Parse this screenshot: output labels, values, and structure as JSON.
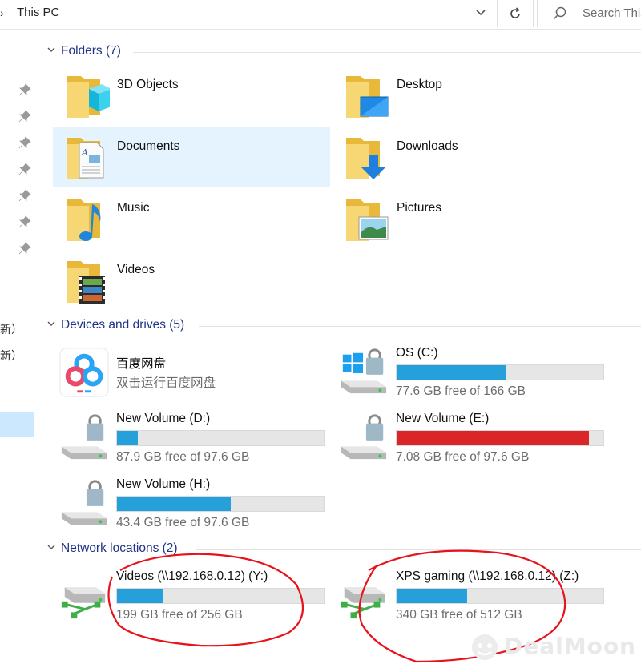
{
  "address_bar": {
    "path": "This PC",
    "search_placeholder": "Search This PC"
  },
  "nav": {
    "fragment_1": "更新）",
    "fragment_2": "更新）"
  },
  "groups": {
    "folders": {
      "title": "Folders (7)"
    },
    "devices": {
      "title": "Devices and drives (5)"
    },
    "network": {
      "title": "Network locations (2)"
    }
  },
  "folders": [
    {
      "name": "3D Objects"
    },
    {
      "name": "Desktop"
    },
    {
      "name": "Documents"
    },
    {
      "name": "Downloads"
    },
    {
      "name": "Music"
    },
    {
      "name": "Pictures"
    },
    {
      "name": "Videos"
    }
  ],
  "baidu": {
    "name": "百度网盘",
    "subtitle": "双击运行百度网盘"
  },
  "drives": [
    {
      "name": "OS (C:)",
      "free": "77.6 GB free of 166 GB",
      "used_fraction": 0.53,
      "bar_color": "#26a0da"
    },
    {
      "name": "New Volume (D:)",
      "free": "87.9 GB free of 97.6 GB",
      "used_fraction": 0.1,
      "bar_color": "#26a0da"
    },
    {
      "name": "New Volume (E:)",
      "free": "7.08 GB free of 97.6 GB",
      "used_fraction": 0.93,
      "bar_color": "#da2626"
    },
    {
      "name": "New Volume (H:)",
      "free": "43.4 GB free of 97.6 GB",
      "used_fraction": 0.55,
      "bar_color": "#26a0da"
    }
  ],
  "network": [
    {
      "name": "Videos (\\\\192.168.0.12) (Y:)",
      "free": "199 GB free of 256 GB",
      "used_fraction": 0.22,
      "bar_color": "#26a0da"
    },
    {
      "name": "XPS gaming (\\\\192.168.0.12) (Z:)",
      "free": "340 GB free of 512 GB",
      "used_fraction": 0.34,
      "bar_color": "#26a0da"
    }
  ],
  "watermark": {
    "text": "DealMoon"
  },
  "colors": {
    "accent": "#1e3287",
    "selection": "#e5f3ff",
    "annotation": "#e8121b"
  }
}
